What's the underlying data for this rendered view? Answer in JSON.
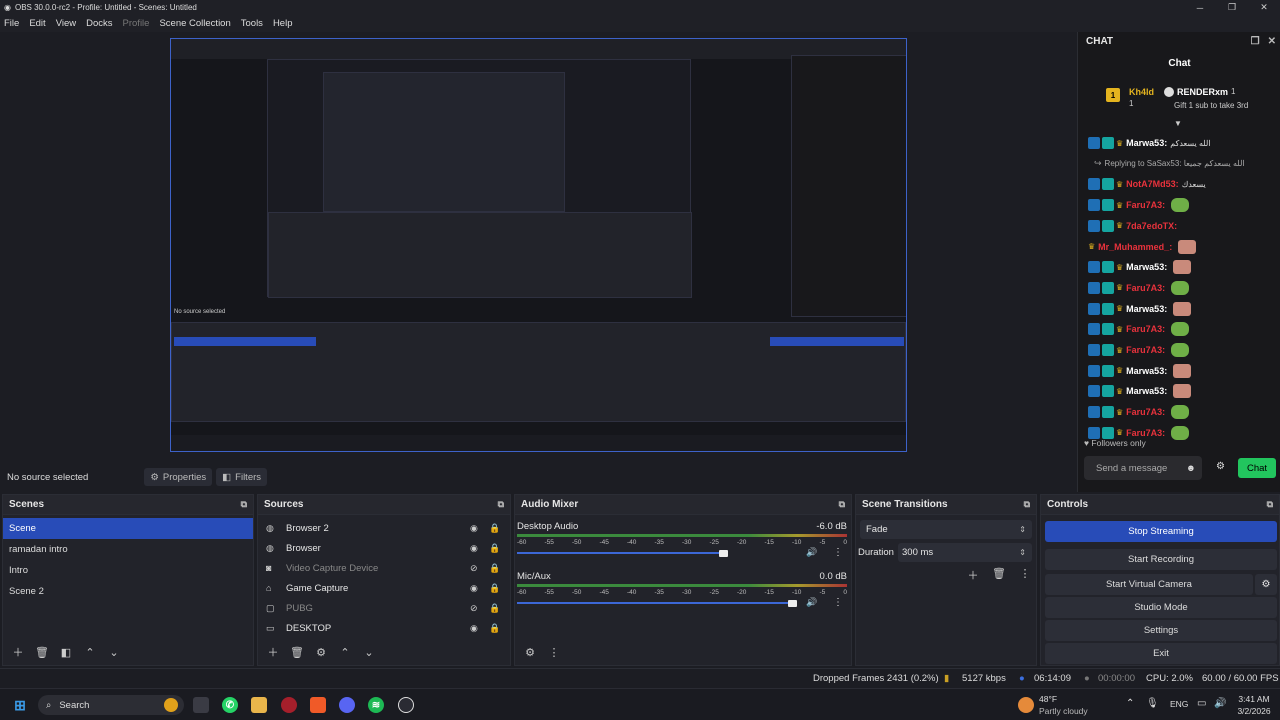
{
  "window": {
    "title": "OBS 30.0.0-rc2 - Profile: Untitled - Scenes: Untitled"
  },
  "menu": [
    "File",
    "Edit",
    "View",
    "Docks",
    "Profile",
    "Scene Collection",
    "Tools",
    "Help"
  ],
  "source_bar": {
    "label": "No source selected",
    "properties": "Properties",
    "filters": "Filters"
  },
  "chat": {
    "dock_title": "CHAT",
    "title": "Chat",
    "leaderboard": {
      "rank1_name": "Kh4ld",
      "rank1_count": "1",
      "rank2_name": "RENDERxm",
      "rank2_count": "1",
      "gift_text": "Gift 1 sub to take 3rd"
    },
    "messages": [
      {
        "user": "Marwa53:",
        "text": "ﺍﻟﻠﻪ ﻳﺴﻌﺪﻛﻢ",
        "color": "#ffffff"
      },
      {
        "user": "",
        "text": "Replying to SaSax53: ﺍﻟﻠﻪ ﻳﺴﻌﺪﻛﻢ ﺟﻤﻴﻌﺎ",
        "color": "#aaaaaa"
      },
      {
        "user": "NotA7Md53:",
        "text": "ﻳﺴﻌﺪﻙ",
        "color": "#e8323c"
      },
      {
        "user": "Faru7A3:",
        "text": "",
        "color": "#e8323c"
      },
      {
        "user": "7da7edoTX:",
        "text": "",
        "color": "#e8323c"
      },
      {
        "user": "Mr_Muhammed_:",
        "text": "",
        "color": "#e8323c"
      },
      {
        "user": "Marwa53:",
        "text": "",
        "color": "#ffffff"
      },
      {
        "user": "Faru7A3:",
        "text": "",
        "color": "#e8323c"
      },
      {
        "user": "Marwa53:",
        "text": "",
        "color": "#ffffff"
      },
      {
        "user": "Faru7A3:",
        "text": "",
        "color": "#e8323c"
      },
      {
        "user": "Faru7A3:",
        "text": "",
        "color": "#e8323c"
      },
      {
        "user": "Marwa53:",
        "text": "",
        "color": "#ffffff"
      },
      {
        "user": "Marwa53:",
        "text": "",
        "color": "#ffffff"
      },
      {
        "user": "Faru7A3:",
        "text": "",
        "color": "#e8323c"
      },
      {
        "user": "Faru7A3:",
        "text": "",
        "color": "#e8323c"
      }
    ],
    "followers_only": "Followers only",
    "input_placeholder": "Send a message",
    "send_button": "Chat"
  },
  "scenes": {
    "title": "Scenes",
    "items": [
      "Scene",
      "ramadan intro",
      "Intro",
      "Scene 2"
    ]
  },
  "sources": {
    "title": "Sources",
    "items": [
      {
        "name": "Browser 2",
        "icon": "globe",
        "dim": false
      },
      {
        "name": "Browser",
        "icon": "globe",
        "dim": false
      },
      {
        "name": "Video Capture Device",
        "icon": "camera",
        "dim": true
      },
      {
        "name": "Game Capture",
        "icon": "gamepad",
        "dim": false
      },
      {
        "name": "PUBG",
        "icon": "window",
        "dim": true
      },
      {
        "name": "DESKTOP",
        "icon": "monitor",
        "dim": false
      }
    ]
  },
  "audio": {
    "title": "Audio Mixer",
    "channels": [
      {
        "name": "Desktop Audio",
        "db": "-6.0 dB",
        "level": 0.72
      },
      {
        "name": "Mic/Aux",
        "db": "0.0 dB",
        "level": 0.96
      }
    ],
    "ticks": [
      "-60",
      "-55",
      "-50",
      "-45",
      "-40",
      "-35",
      "-30",
      "-25",
      "-20",
      "-15",
      "-10",
      "-5",
      "0"
    ]
  },
  "transitions": {
    "title": "Scene Transitions",
    "type": "Fade",
    "duration_label": "Duration",
    "duration": "300 ms"
  },
  "controls": {
    "title": "Controls",
    "buttons": [
      "Stop Streaming",
      "Start Recording",
      "Start Virtual Camera",
      "Studio Mode",
      "Settings",
      "Exit"
    ]
  },
  "status": {
    "dropped": "Dropped Frames 2431 (0.2%)",
    "kbps": "5127 kbps",
    "live_time": "06:14:09",
    "rec_time": "00:00:00",
    "cpu": "CPU: 2.0%",
    "fps": "60.00 / 60.00 FPS"
  },
  "taskbar": {
    "search": "Search",
    "weather_temp": "48°F",
    "weather_desc": "Partly cloudy",
    "lang": "ENG",
    "time": "3:41 AM",
    "date": "3/2/2026"
  },
  "nested": {
    "no_source": "No source selected"
  }
}
